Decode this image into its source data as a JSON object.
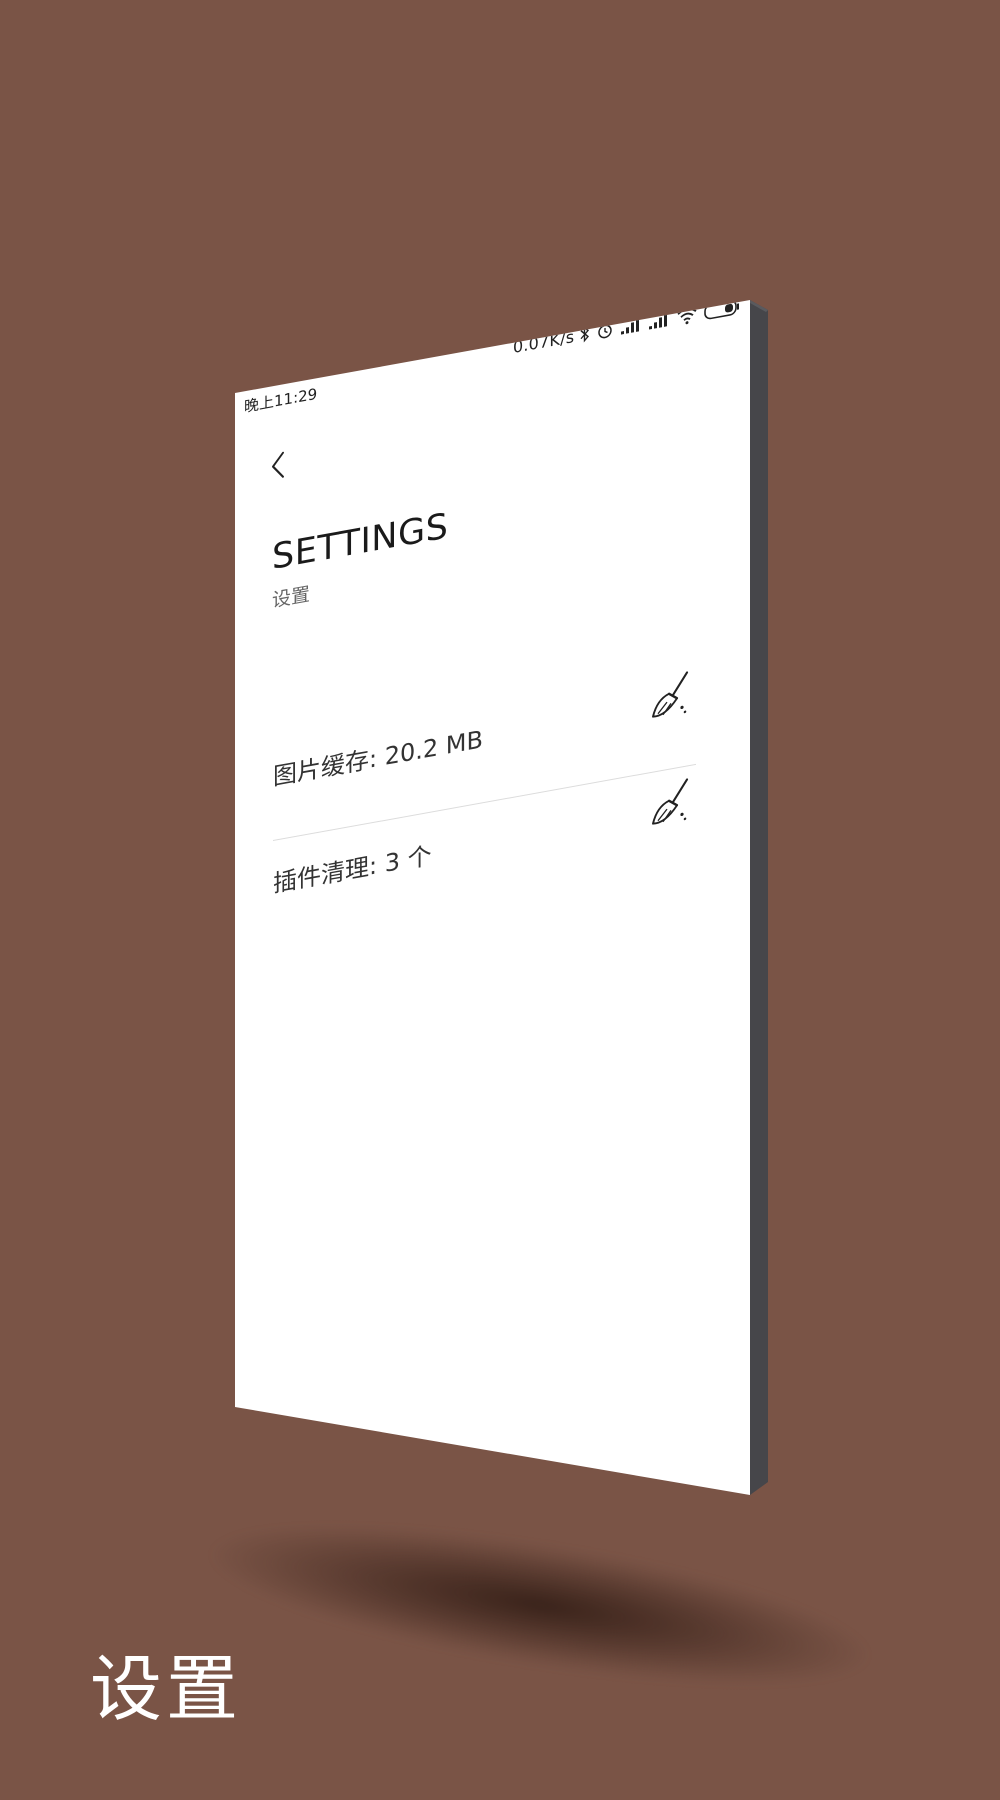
{
  "status_bar": {
    "time": "晚上11:29",
    "network_speed": "0.07K/s",
    "icons": [
      "bluetooth-icon",
      "alarm-icon",
      "signal-icon",
      "signal-icon",
      "wifi-icon",
      "battery-icon"
    ]
  },
  "header": {
    "back_icon": "chevron-left-icon",
    "title": "SETTINGS",
    "subtitle": "设置"
  },
  "settings": {
    "items": [
      {
        "label": "图片缓存",
        "separator": ": ",
        "value": "20.2 MB",
        "action_icon": "broom-icon"
      },
      {
        "label": "插件清理",
        "separator": ": ",
        "value": "3 个",
        "action_icon": "broom-icon"
      }
    ]
  },
  "caption": "设置",
  "colors": {
    "background": "#7a5446",
    "screen": "#ffffff",
    "phone_edge": "#4a4a4c",
    "caption_text": "#ffffff"
  }
}
